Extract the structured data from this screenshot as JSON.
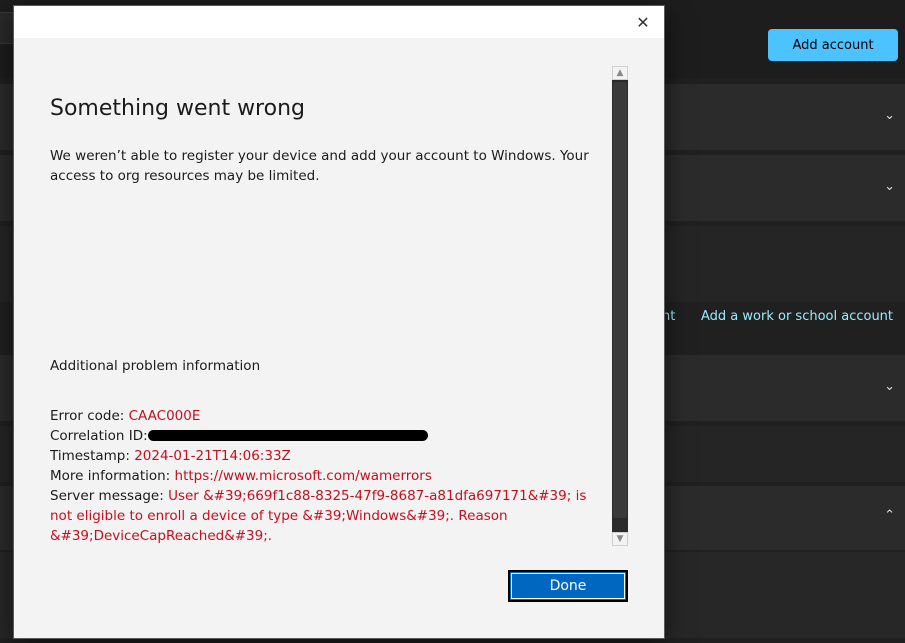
{
  "background": {
    "add_account_label": "Add account",
    "link_partial": "nt",
    "link_work_school": "Add a work or school account"
  },
  "dialog": {
    "close_symbol": "✕",
    "title": "Something went wrong",
    "message": "We weren’t able to register your device and add your account to Windows. Your access to org resources may be limited.",
    "additional_title": "Additional problem information",
    "error_code_label": "Error code: ",
    "error_code": "CAAC000E",
    "correlation_label": "Correlation ID:",
    "timestamp_label": "Timestamp: ",
    "timestamp": "2024-01-21T14:06:33Z",
    "more_info_label": "More information: ",
    "more_info": "https://www.microsoft.com/wamerrors",
    "server_message_label": "Server message: ",
    "server_message": "User &#39;669f1c88-8325-47f9-8687-a81dfa697171&#39; is not eligible to enroll a device of type &#39;Windows&#39;. Reason &#39;DeviceCapReached&#39;.",
    "done_label": "Done"
  },
  "colors": {
    "accent": "#0067c0",
    "error_text": "#c50f1f",
    "link": "#99ebff",
    "add_account_bg": "#4cc2ff"
  },
  "icons": {
    "close": "close-icon",
    "chevron_down": "chevron-down-icon",
    "chevron_up": "chevron-up-icon"
  }
}
